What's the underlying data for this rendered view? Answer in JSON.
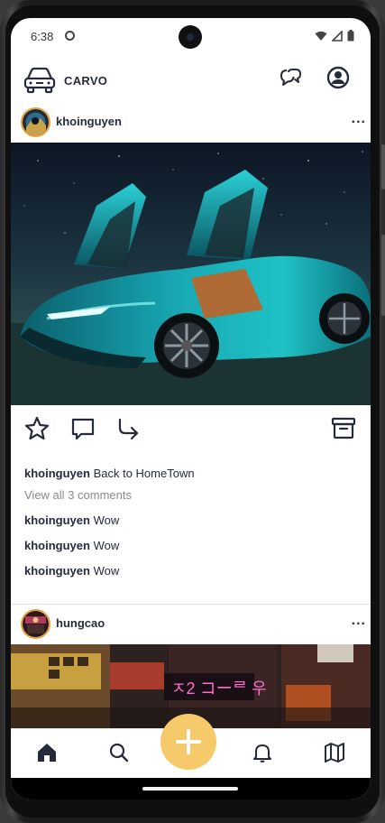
{
  "status_bar": {
    "time": "6:38"
  },
  "header": {
    "brand": "CARVO",
    "logo_icon": "car-icon",
    "chat_icon": "chat-bubbles-icon",
    "profile_icon": "user-circle-icon"
  },
  "posts": [
    {
      "username": "khoinguyen",
      "more_label": "...",
      "image_alt": "teal supercar with butterfly doors open under a starry sky",
      "caption_user": "khoinguyen",
      "caption_text": "Back to HomeTown",
      "view_comments": "View all 3 comments",
      "comments": [
        {
          "user": "khoinguyen",
          "text": "Wow"
        },
        {
          "user": "khoinguyen",
          "text": "Wow"
        },
        {
          "user": "khoinguyen",
          "text": "Wow"
        }
      ]
    },
    {
      "username": "hungcao",
      "more_label": "...",
      "image_alt": "neon-lit street at night"
    }
  ],
  "actions": {
    "icons": [
      "star-icon",
      "comment-icon",
      "share-icon",
      "archive-icon"
    ]
  },
  "bottom_nav": {
    "items": [
      "home-icon",
      "search-icon",
      "add-icon",
      "bell-icon",
      "map-icon"
    ]
  },
  "colors": {
    "brand_dark": "#262b3c",
    "fab": "#f6c96b",
    "avatar_ring": "#e7a23b",
    "muted_text": "#8a8a8a"
  }
}
